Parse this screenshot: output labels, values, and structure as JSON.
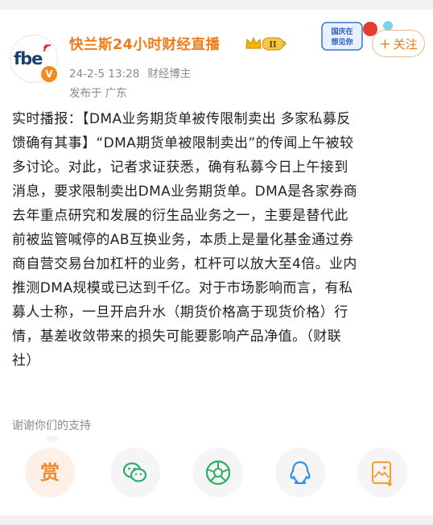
{
  "post": {
    "author": "快兰斯24小时财经直播",
    "avatar_text": "fbe",
    "verified_badge": "V",
    "level_badge": "II",
    "date": "24-2-5 13:28",
    "author_type": "财经博主",
    "location": "发布于 广东",
    "follow_label": "关注",
    "promo_text": "国庆在\n想见你",
    "content_lines": [
      "实时播报：【DMA业务期货单被传限制卖出 多家私募反",
      "馈确有其事】“DMA期货单被限制卖出”的传闻上午被较",
      "多讨论。对此，记者求证获悉，确有私募今日上午接到",
      "消息，要求限制卖出DMA业务期货单。DMA是各家券商",
      "去年重点研究和发展的衍生品业务之一，主要是替代此",
      "前被监管喊停的AB互换业务，本质上是量化基金通过券",
      "商自营交易台加杠杆的业务，杠杆可以放大至4倍。业内",
      "推测DMA规模或已达到千亿。对于市场影响而言，有私",
      "募人士称，一旦开启升水（期货价格高于现货价格）行",
      "情，基差收敛带来的损失可能要影响产品净值。（财联",
      "社）"
    ]
  },
  "support": {
    "thanks_text": "谢谢你们的支持",
    "reward_label": "赏"
  },
  "share": [
    {
      "icon": "reward-icon"
    },
    {
      "icon": "wechat-icon"
    },
    {
      "icon": "moments-icon"
    },
    {
      "icon": "qq-icon"
    },
    {
      "icon": "save-image-icon"
    }
  ],
  "colors": {
    "accent": "#ef7b1a",
    "muted": "#8a8a8a",
    "text": "#222222"
  }
}
